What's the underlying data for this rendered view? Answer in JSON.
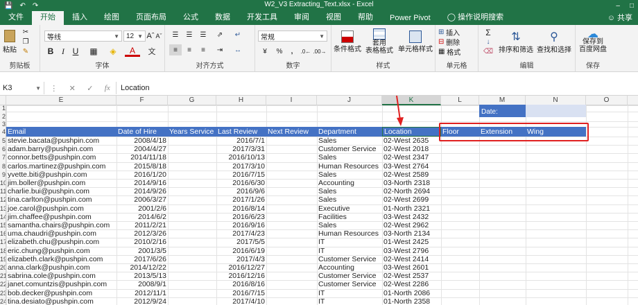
{
  "window": {
    "title": "W2_V3 Extracting_Text.xlsx  -  Excel"
  },
  "tabs": [
    "文件",
    "开始",
    "插入",
    "绘图",
    "页面布局",
    "公式",
    "数据",
    "开发工具",
    "审阅",
    "视图",
    "帮助",
    "Power Pivot",
    "操作说明搜索"
  ],
  "share": "共享",
  "ribbon": {
    "paste": "粘贴",
    "clipboard": "剪贴板",
    "font_name": "等线",
    "font_size": "12",
    "font_group": "字体",
    "align_group": "对齐方式",
    "number_format": "常规",
    "number_group": "数字",
    "cond_format": "条件格式",
    "table_format_1": "套用",
    "table_format_2": "表格格式",
    "cell_styles": "单元格样式",
    "styles_group": "样式",
    "insert": "插入",
    "delete": "删除",
    "format": "格式",
    "cells_group": "单元格",
    "sort_filter": "排序和筛选",
    "find_select": "查找和选择",
    "edit_group": "编辑",
    "save_1": "保存到",
    "save_2": "百度网盘",
    "save_group": "保存",
    "bold": "B",
    "italic": "I",
    "underline": "U",
    "font_color": "A",
    "percent": "%",
    "comma": ","
  },
  "formula_bar": {
    "name_box": "K3",
    "content": "Location"
  },
  "columns": [
    "E",
    "F",
    "G",
    "H",
    "I",
    "J",
    "K",
    "L",
    "M",
    "N",
    "O"
  ],
  "row_numbers": [
    "1",
    "2",
    "3",
    "4",
    "5",
    "6",
    "7",
    "8",
    "9",
    "10",
    "11",
    "12",
    "13",
    "14",
    "15",
    "16",
    "17",
    "18",
    "19",
    "20",
    "21",
    "22",
    "23",
    "24"
  ],
  "date_label": "Date:",
  "headers": {
    "email": "Email",
    "hire": "Date of Hire",
    "years": "Years Service",
    "review": "Last Review",
    "next": "Next Review",
    "dept": "Department",
    "loc": "Location",
    "floor": "Floor",
    "ext": "Extension",
    "wing": "Wing"
  },
  "rows": [
    [
      "stevie.bacata@pushpin.com",
      "2008/4/18",
      "2016/7/1",
      "Sales",
      "02-West 2635"
    ],
    [
      "adam.barry@pushpin.com",
      "2004/4/27",
      "2017/3/31",
      "Customer Service",
      "02-West 2018"
    ],
    [
      "connor.betts@pushpin.com",
      "2014/11/18",
      "2016/10/13",
      "Sales",
      "02-West 2347"
    ],
    [
      "carlos.martinez@pushpin.com",
      "2015/8/18",
      "2017/3/10",
      "Human Resources",
      "03-West 2764"
    ],
    [
      "yvette.biti@pushpin.com",
      "2016/1/20",
      "2016/7/15",
      "Sales",
      "02-West 2589"
    ],
    [
      "jim.boller@pushpin.com",
      "2014/9/16",
      "2016/6/30",
      "Accounting",
      "03-North 2318"
    ],
    [
      "charlie.bui@pushpin.com",
      "2014/9/26",
      "2016/9/6",
      "Sales",
      "02-North 2694"
    ],
    [
      "tina.carlton@pushpin.com",
      "2006/3/27",
      "2017/1/26",
      "Sales",
      "02-West 2699"
    ],
    [
      "joe.carol@pushpin.com",
      "2001/2/6",
      "2016/8/14",
      "Executive",
      "01-North 2321"
    ],
    [
      "jim.chaffee@pushpin.com",
      "2014/6/2",
      "2016/6/23",
      "Facilities",
      "03-West 2432"
    ],
    [
      "samantha.chairs@pushpin.com",
      "2011/2/21",
      "2016/9/16",
      "Sales",
      "02-West 2962"
    ],
    [
      "uma.chaudri@pushpin.com",
      "2012/3/26",
      "2017/4/23",
      "Human Resources",
      "03-North 2134"
    ],
    [
      "elizabeth.chu@pushpin.com",
      "2010/2/16",
      "2017/5/5",
      "IT",
      "01-West 2425"
    ],
    [
      "eric.chung@pushpin.com",
      "2001/3/5",
      "2016/6/19",
      "IT",
      "03-West 2796"
    ],
    [
      "elizabeth.clark@pushpin.com",
      "2017/6/26",
      "2017/4/3",
      "Customer Service",
      "02-West 2414"
    ],
    [
      "anna.clark@pushpin.com",
      "2014/12/22",
      "2016/12/27",
      "Accounting",
      "03-West 2601"
    ],
    [
      "sabrina.cole@pushpin.com",
      "2013/5/13",
      "2016/12/16",
      "Customer Service",
      "02-West 2537"
    ],
    [
      "janet.comuntzis@pushpin.com",
      "2008/9/1",
      "2016/8/16",
      "Customer Service",
      "02-West 2286"
    ],
    [
      "bob.decker@pushpin.com",
      "2012/11/1",
      "2016/7/15",
      "IT",
      "01-North 2086"
    ],
    [
      "tina.desiato@pushpin.com",
      "2012/9/24",
      "2017/4/10",
      "IT",
      "01-North 2358"
    ]
  ],
  "colors": {
    "excel_green": "#217346",
    "header_blue": "#4472c4",
    "date_fill": "#d9e1f2",
    "annotation_red": "#e02020"
  }
}
